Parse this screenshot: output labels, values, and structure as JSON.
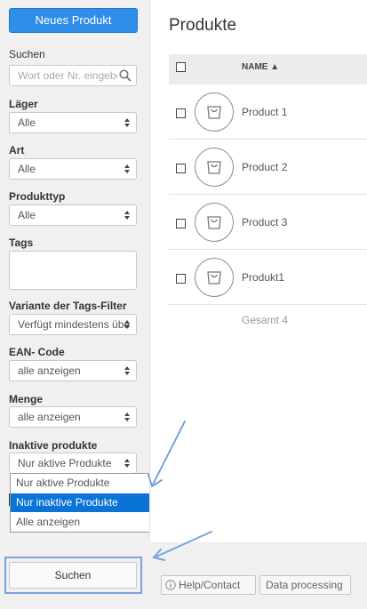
{
  "sidebar": {
    "new_product_label": "Neues Produkt",
    "search": {
      "label": "Suchen",
      "placeholder": "Wort oder Nr. eingeben"
    },
    "filters": [
      {
        "key": "laeger",
        "label": "Läger",
        "value": "Alle"
      },
      {
        "key": "art",
        "label": "Art",
        "value": "Alle"
      },
      {
        "key": "produkttyp",
        "label": "Produkttyp",
        "value": "Alle"
      }
    ],
    "tags": {
      "label": "Tags",
      "value": ""
    },
    "tags_variant": {
      "label": "Variante der Tags-Filter",
      "value": "Verfügt mindestens über"
    },
    "ean": {
      "label": "EAN- Code",
      "value": "alle anzeigen"
    },
    "menge": {
      "label": "Menge",
      "value": "alle anzeigen"
    },
    "inactive": {
      "label": "Inaktive produkte",
      "value": "Nur aktive Produkte",
      "options": [
        "Nur aktive Produkte",
        "Nur inaktive Produkte",
        "Alle anzeigen"
      ],
      "highlighted_option": "Nur inaktive Produkte"
    },
    "search_button_label": "Suchen"
  },
  "main": {
    "title": "Produkte",
    "table": {
      "column_name": "NAME ▲",
      "rows": [
        {
          "name": "Product 1"
        },
        {
          "name": "Product 2"
        },
        {
          "name": "Product 3"
        },
        {
          "name": "Produkt1"
        }
      ],
      "total": "Gesamt 4"
    }
  },
  "footer": {
    "help_label": "Help/Contact",
    "data_processing_label": "Data processing"
  },
  "colors": {
    "primary": "#2f8ee8",
    "selected": "#0a74d6",
    "annotation_arrow": "#7aa3de"
  },
  "icons": {
    "search": "search-icon",
    "select_arrows": "select-arrows-icon",
    "product": "shopping-bag-icon",
    "info": "info-icon"
  }
}
